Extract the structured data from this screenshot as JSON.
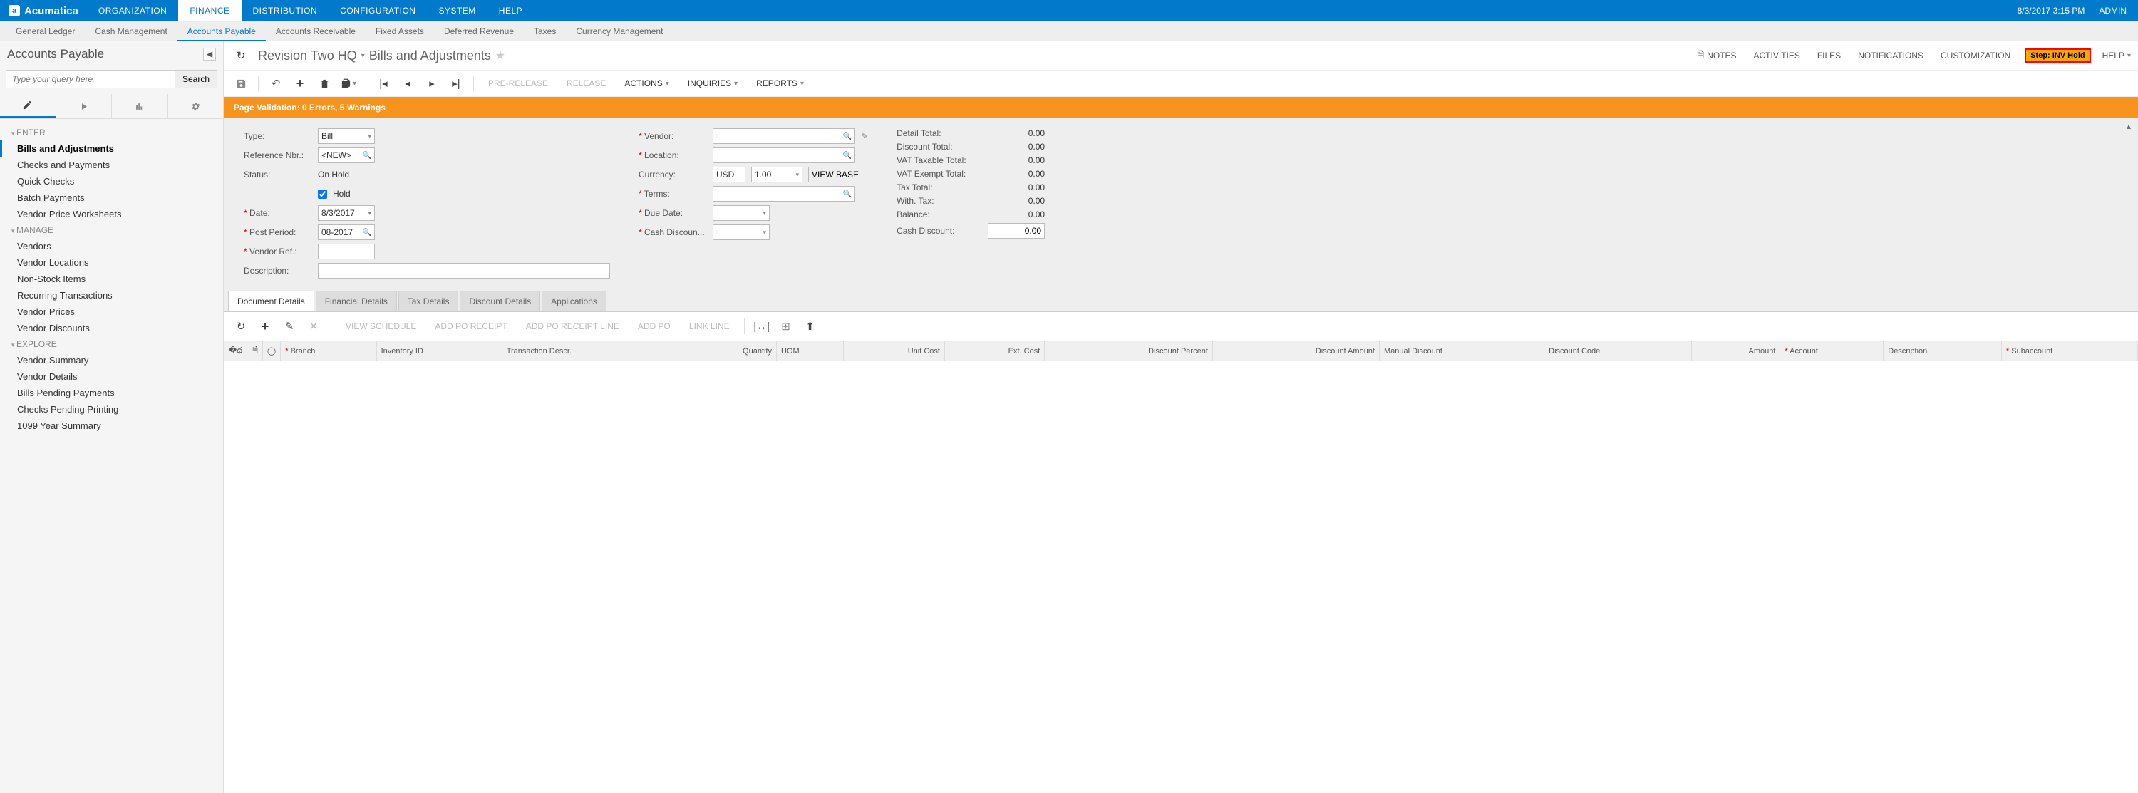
{
  "brand": "Acumatica",
  "datetime": "8/3/2017  3:15 PM",
  "user": "ADMIN",
  "topnav": [
    "ORGANIZATION",
    "FINANCE",
    "DISTRIBUTION",
    "CONFIGURATION",
    "SYSTEM",
    "HELP"
  ],
  "topnav_active": 1,
  "subnav": [
    "General Ledger",
    "Cash Management",
    "Accounts Payable",
    "Accounts Receivable",
    "Fixed Assets",
    "Deferred Revenue",
    "Taxes",
    "Currency Management"
  ],
  "subnav_active": 2,
  "sidebar": {
    "title": "Accounts Payable",
    "search_placeholder": "Type your query here",
    "search_btn": "Search",
    "sections": [
      {
        "title": "ENTER",
        "items": [
          "Bills and Adjustments",
          "Checks and Payments",
          "Quick Checks",
          "Batch Payments",
          "Vendor Price Worksheets"
        ],
        "active": 0
      },
      {
        "title": "MANAGE",
        "items": [
          "Vendors",
          "Vendor Locations",
          "Non-Stock Items",
          "Recurring Transactions",
          "Vendor Prices",
          "Vendor Discounts"
        ]
      },
      {
        "title": "EXPLORE",
        "items": [
          "Vendor Summary",
          "Vendor Details",
          "Bills Pending Payments",
          "Checks Pending Printing",
          "1099 Year Summary"
        ]
      }
    ]
  },
  "page": {
    "company": "Revision Two HQ",
    "title": "Bills and Adjustments",
    "links": {
      "notes": "NOTES",
      "activities": "ACTIVITIES",
      "files": "FILES",
      "notifications": "NOTIFICATIONS",
      "customization": "CUSTOMIZATION",
      "help": "HELP"
    },
    "step": "Step: INV Hold"
  },
  "toolbar": {
    "prerelease": "PRE-RELEASE",
    "release": "RELEASE",
    "actions": "ACTIONS",
    "inquiries": "INQUIRIES",
    "reports": "REPORTS"
  },
  "validation": "Page Validation: 0 Errors, 5 Warnings",
  "form": {
    "type_label": "Type:",
    "type_value": "Bill",
    "ref_label": "Reference Nbr.:",
    "ref_value": "<NEW>",
    "status_label": "Status:",
    "status_value": "On Hold",
    "hold_label": "Hold",
    "hold_checked": true,
    "date_label": "Date:",
    "date_value": "8/3/2017",
    "post_label": "Post Period:",
    "post_value": "08-2017",
    "vref_label": "Vendor Ref.:",
    "desc_label": "Description:",
    "vendor_label": "Vendor:",
    "location_label": "Location:",
    "currency_label": "Currency:",
    "currency_code": "USD",
    "currency_rate": "1.00",
    "view_base": "VIEW BASE",
    "terms_label": "Terms:",
    "due_label": "Due Date:",
    "cashdisc_label": "Cash Discoun..."
  },
  "totals": {
    "detail": "Detail Total:",
    "detail_v": "0.00",
    "discount": "Discount Total:",
    "discount_v": "0.00",
    "vat_tax": "VAT Taxable Total:",
    "vat_tax_v": "0.00",
    "vat_ex": "VAT Exempt Total:",
    "vat_ex_v": "0.00",
    "tax": "Tax Total:",
    "tax_v": "0.00",
    "with": "With. Tax:",
    "with_v": "0.00",
    "balance": "Balance:",
    "balance_v": "0.00",
    "cash": "Cash Discount:",
    "cash_v": "0.00"
  },
  "tabs": [
    "Document Details",
    "Financial Details",
    "Tax Details",
    "Discount Details",
    "Applications"
  ],
  "tabs_active": 0,
  "grid_toolbar": {
    "view_schedule": "VIEW SCHEDULE",
    "add_po_receipt": "ADD PO RECEIPT",
    "add_po_receipt_line": "ADD PO RECEIPT LINE",
    "add_po": "ADD PO",
    "link_line": "LINK LINE"
  },
  "grid_cols": [
    {
      "label": "Branch",
      "req": true
    },
    {
      "label": "Inventory ID"
    },
    {
      "label": "Transaction Descr."
    },
    {
      "label": "Quantity",
      "r": true
    },
    {
      "label": "UOM"
    },
    {
      "label": "Unit Cost",
      "r": true
    },
    {
      "label": "Ext. Cost",
      "r": true
    },
    {
      "label": "Discount Percent",
      "r": true
    },
    {
      "label": "Discount Amount",
      "r": true
    },
    {
      "label": "Manual Discount"
    },
    {
      "label": "Discount Code"
    },
    {
      "label": "Amount",
      "r": true
    },
    {
      "label": "Account",
      "req": true
    },
    {
      "label": "Description"
    },
    {
      "label": "Subaccount",
      "req": true
    }
  ]
}
